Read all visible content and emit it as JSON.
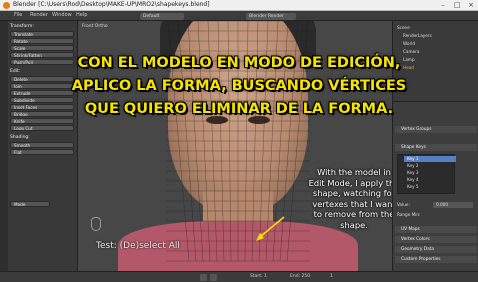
{
  "window": {
    "title": "Blender [C:\\Users\\Rod\\Desktop\\MAKE-UP\\MRO2\\shapekeys.blend]"
  },
  "header": {
    "menus": [
      "File",
      "Render",
      "Window",
      "Help"
    ],
    "layout": "Default",
    "engine": "Blender Render"
  },
  "toolshelf": {
    "sections": [
      "Transform:",
      "Edit:",
      "Shading:"
    ],
    "buttons": [
      "Translate",
      "Rotate",
      "Scale",
      "Shrink/Fatten",
      "Push/Pull",
      "Delete",
      "Join",
      "Extrude",
      "Subdivide",
      "Inset Faces",
      "Bridge",
      "Knife",
      "Loop Cut",
      "Smooth",
      "Flat"
    ],
    "mode": "Mode"
  },
  "viewport": {
    "label": "Front Ortho",
    "operator": "Test: (De)select All"
  },
  "caption": [
    "CON EL MODELO EN MODO DE EDICIÓN,",
    "APLICO LA FORMA, BUSCANDO VÉRTICES",
    "QUE QUIERO ELIMINAR DE LA FORMA."
  ],
  "subtitle": [
    "With the model in",
    "Edit Mode, I apply the",
    "shape, watching for",
    "vertexes that I want",
    "to remove from the",
    "shape."
  ],
  "outliner": {
    "items": [
      "Scene",
      "RenderLayers",
      "World",
      "Camera",
      "Lamp",
      "Head"
    ]
  },
  "properties": {
    "panels": [
      "Vertex Groups",
      "Shape Keys",
      "UV Maps",
      "Vertex Colors",
      "Geometry Data",
      "Custom Properties"
    ],
    "shape_keys": [
      "Key 1",
      "Key 2",
      "Key 3",
      "Key 4",
      "Key 5"
    ],
    "value_label": "Value:",
    "value": "0.000",
    "range_label": "Range Min:"
  },
  "timeline": {
    "start": "Start: 1",
    "end": "End: 250",
    "frame": "1"
  },
  "colors": {
    "caption": "#f5e400",
    "selection": "#5680c2"
  }
}
